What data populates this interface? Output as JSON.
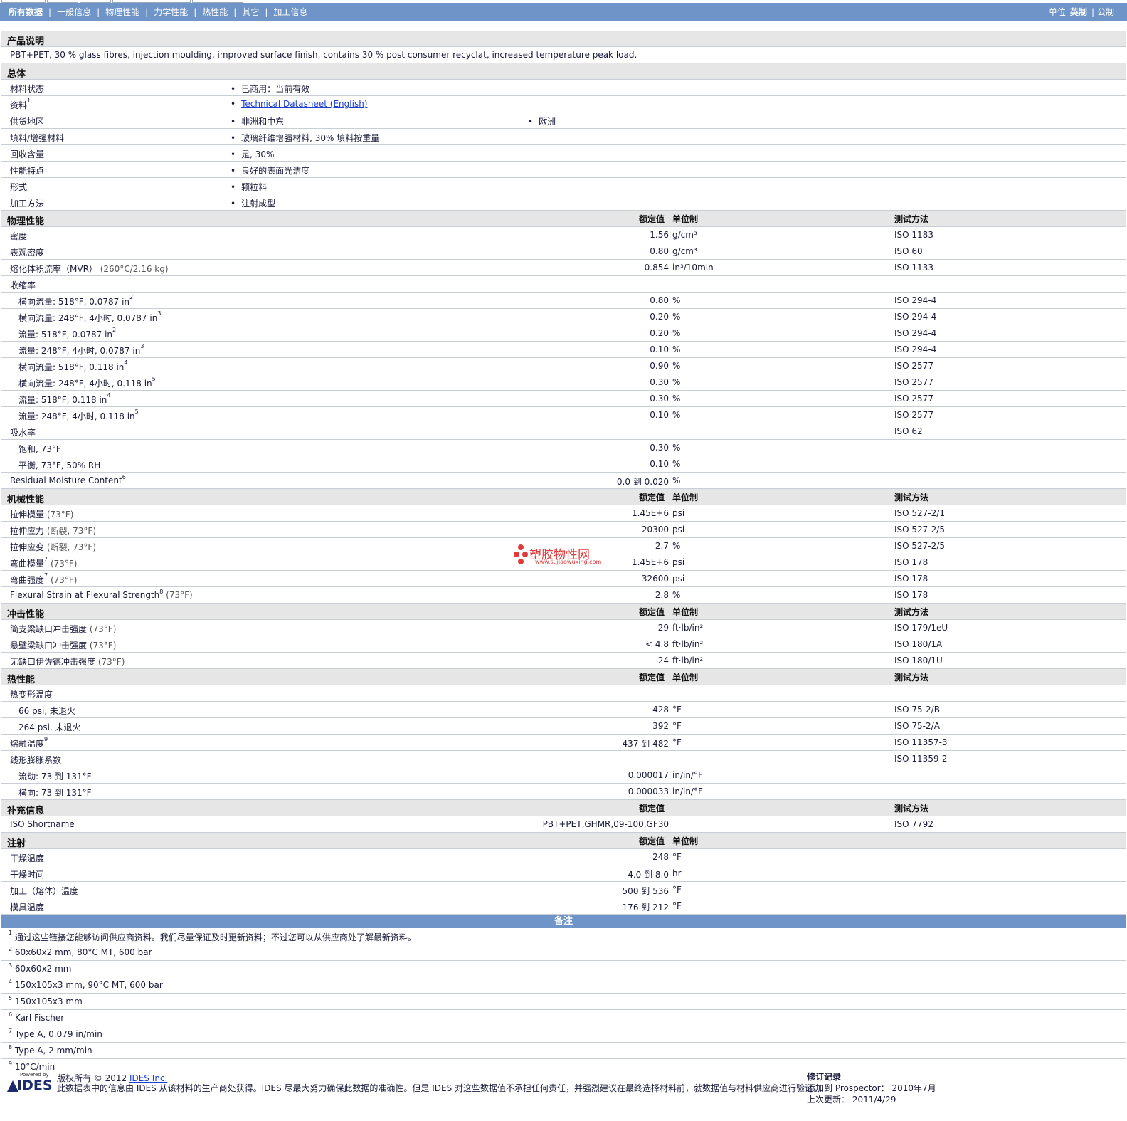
{
  "nav": {
    "tabs": [
      "所有数据",
      "一般信息",
      "物理性能",
      "力学性能",
      "热性能",
      "其它",
      "加工信息"
    ],
    "unit_label": "单位",
    "unit_active": "英制",
    "unit_alt": "公制"
  },
  "description": {
    "header": "产品说明",
    "text": "PBT+PET, 30 % glass fibres, injection moulding, improved surface finish, contains 30 % post consumer recyclat, increased temperature peak load."
  },
  "general": {
    "header": "总体",
    "rows": [
      {
        "label": "材料状态",
        "v1": "已商用：当前有效",
        "v2": ""
      },
      {
        "label": "资料",
        "sup": "1",
        "v1": "Technical Datasheet (English)",
        "v2": ""
      },
      {
        "label": "供货地区",
        "v1": "非洲和中东",
        "v2": "欧洲"
      },
      {
        "label": "填料/增强材料",
        "v1": "玻璃纤维增强材料, 30% 填料按重量",
        "v2": ""
      },
      {
        "label": "回收含量",
        "v1": "是, 30%",
        "v2": ""
      },
      {
        "label": "性能特点",
        "v1": "良好的表面光洁度",
        "v2": ""
      },
      {
        "label": "形式",
        "v1": "颗粒料",
        "v2": ""
      },
      {
        "label": "加工方法",
        "v1": "注射成型",
        "v2": ""
      }
    ]
  },
  "columns": {
    "value": "额定值",
    "unit": "单位制",
    "test": "测试方法"
  },
  "physical": {
    "header": "物理性能",
    "rows": [
      {
        "label": "密度",
        "value": "1.56",
        "unit": "g/cm³",
        "test": "ISO 1183"
      },
      {
        "label": "表观密度",
        "value": "0.80",
        "unit": "g/cm³",
        "test": "ISO 60"
      },
      {
        "label": "熔化体积流率（MVR）",
        "cond": "(260°C/2.16 kg)",
        "value": "0.854",
        "unit": "in³/10min",
        "test": "ISO 1133"
      },
      {
        "label": "收缩率",
        "value": "",
        "unit": "",
        "test": ""
      },
      {
        "label": "横向流量: 518°F, 0.0787 in",
        "sup": "2",
        "indent": true,
        "value": "0.80",
        "unit": "%",
        "test": "ISO 294-4"
      },
      {
        "label": "横向流量: 248°F, 4小时, 0.0787 in",
        "sup": "3",
        "indent": true,
        "value": "0.20",
        "unit": "%",
        "test": "ISO 294-4"
      },
      {
        "label": "流量: 518°F, 0.0787 in",
        "sup": "2",
        "indent": true,
        "value": "0.20",
        "unit": "%",
        "test": "ISO 294-4"
      },
      {
        "label": "流量: 248°F, 4小时, 0.0787 in",
        "sup": "3",
        "indent": true,
        "value": "0.10",
        "unit": "%",
        "test": "ISO 294-4"
      },
      {
        "label": "横向流量: 518°F, 0.118 in",
        "sup": "4",
        "indent": true,
        "value": "0.90",
        "unit": "%",
        "test": "ISO 2577"
      },
      {
        "label": "横向流量: 248°F, 4小时, 0.118 in",
        "sup": "5",
        "indent": true,
        "value": "0.30",
        "unit": "%",
        "test": "ISO 2577"
      },
      {
        "label": "流量: 518°F, 0.118 in",
        "sup": "4",
        "indent": true,
        "value": "0.30",
        "unit": "%",
        "test": "ISO 2577"
      },
      {
        "label": "流量: 248°F, 4小时, 0.118 in",
        "sup": "5",
        "indent": true,
        "value": "0.10",
        "unit": "%",
        "test": "ISO 2577"
      },
      {
        "label": "吸水率",
        "value": "",
        "unit": "",
        "test": "ISO 62"
      },
      {
        "label": "饱和, 73°F",
        "indent": true,
        "value": "0.30",
        "unit": "%",
        "test": ""
      },
      {
        "label": "平衡, 73°F, 50% RH",
        "indent": true,
        "value": "0.10",
        "unit": "%",
        "test": ""
      },
      {
        "label": "Residual Moisture Content",
        "sup": "6",
        "value": "0.0 到  0.020",
        "unit": "%",
        "test": ""
      }
    ]
  },
  "mechanical": {
    "header": "机械性能",
    "rows": [
      {
        "label": "拉伸模量",
        "cond": "(73°F)",
        "value": "1.45E+6",
        "unit": "psi",
        "test": "ISO 527-2/1"
      },
      {
        "label": "拉伸应力",
        "cond": "(断裂, 73°F)",
        "value": "20300",
        "unit": "psi",
        "test": "ISO 527-2/5"
      },
      {
        "label": "拉伸应变",
        "cond": "(断裂, 73°F)",
        "value": "2.7",
        "unit": "%",
        "test": "ISO 527-2/5"
      },
      {
        "label": "弯曲模量",
        "sup": "7",
        "cond": "(73°F)",
        "value": "1.45E+6",
        "unit": "psi",
        "test": "ISO 178"
      },
      {
        "label": "弯曲强度",
        "sup": "7",
        "cond": "(73°F)",
        "value": "32600",
        "unit": "psi",
        "test": "ISO 178"
      },
      {
        "label": "Flexural Strain at Flexural Strength",
        "sup": "8",
        "cond": "(73°F)",
        "value": "2.8",
        "unit": "%",
        "test": "ISO 178"
      }
    ]
  },
  "impact": {
    "header": "冲击性能",
    "rows": [
      {
        "label": "简支梁缺口冲击强度",
        "cond": "(73°F)",
        "value": "29",
        "unit": "ft·lb/in²",
        "test": "ISO 179/1eU"
      },
      {
        "label": "悬壁梁缺口冲击强度",
        "cond": "(73°F)",
        "value": "< 4.8",
        "unit": "ft·lb/in²",
        "test": "ISO 180/1A"
      },
      {
        "label": "无缺口伊佐德冲击强度",
        "cond": "(73°F)",
        "value": "24",
        "unit": "ft·lb/in²",
        "test": "ISO 180/1U"
      }
    ]
  },
  "thermal": {
    "header": "热性能",
    "rows": [
      {
        "label": "热变形温度",
        "value": "",
        "unit": "",
        "test": ""
      },
      {
        "label": "66 psi, 未退火",
        "indent": true,
        "value": "428",
        "unit": "°F",
        "test": "ISO 75-2/B"
      },
      {
        "label": "264 psi, 未退火",
        "indent": true,
        "value": "392",
        "unit": "°F",
        "test": "ISO 75-2/A"
      },
      {
        "label": "熔融温度",
        "sup": "9",
        "value": "437 到  482",
        "unit": "°F",
        "test": "ISO 11357-3"
      },
      {
        "label": "线形膨胀系数",
        "value": "",
        "unit": "",
        "test": "ISO 11359-2"
      },
      {
        "label": "流动: 73 到  131°F",
        "indent": true,
        "value": "0.000017",
        "unit": "in/in/°F",
        "test": ""
      },
      {
        "label": "横向: 73 到  131°F",
        "indent": true,
        "value": "0.000033",
        "unit": "in/in/°F",
        "test": ""
      }
    ]
  },
  "additional": {
    "header": "补充信息",
    "rows": [
      {
        "label": "ISO Shortname",
        "value": "PBT+PET,GHMR,09-100,GF30",
        "unit": "",
        "test": "ISO 7792"
      }
    ]
  },
  "injection": {
    "header": "注射",
    "rows": [
      {
        "label": "干燥温度",
        "value": "248",
        "unit": "°F",
        "test": ""
      },
      {
        "label": "干燥时间",
        "value": "4.0 到  8.0",
        "unit": "hr",
        "test": ""
      },
      {
        "label": "加工（熔体）温度",
        "value": "500 到  536",
        "unit": "°F",
        "test": ""
      },
      {
        "label": "模具温度",
        "value": "176 到  212",
        "unit": "°F",
        "test": ""
      }
    ]
  },
  "notes": {
    "header": "备注",
    "items": [
      {
        "num": "1",
        "text": "通过这些链接您能够访问供应商资料。我们尽量保证及时更新资料；不过您可以从供应商处了解最新资料。"
      },
      {
        "num": "2",
        "text": "60x60x2 mm, 80°C MT, 600 bar"
      },
      {
        "num": "3",
        "text": "60x60x2 mm"
      },
      {
        "num": "4",
        "text": "150x105x3 mm, 90°C MT, 600 bar"
      },
      {
        "num": "5",
        "text": "150x105x3 mm"
      },
      {
        "num": "6",
        "text": "Karl Fischer"
      },
      {
        "num": "7",
        "text": "Type A, 0.079 in/min"
      },
      {
        "num": "8",
        "text": "Type A, 2 mm/min"
      },
      {
        "num": "9",
        "text": "10°C/min"
      }
    ]
  },
  "watermark": {
    "name": "塑胶物性网",
    "url": "www.sujiaowuxing.com"
  },
  "footer": {
    "logo_small": "Powered by",
    "logo_big": "IDES",
    "copyright_prefix": "版权所有 © 2012",
    "copyright_link": "IDES Inc.",
    "disclaimer": "此数据表中的信息由 IDES 从该材料的生产商处获得。IDES 尽最大努力确保此数据的准确性。但是 IDES 对这些数据值不承担任何责任，并强烈建议在最终选择材料前，就数据值与材料供应商进行验证。",
    "revision_header": "修订记录",
    "added": "添加到 Prospector： 2010年7月",
    "updated": "上次更新： 2011/4/29"
  }
}
